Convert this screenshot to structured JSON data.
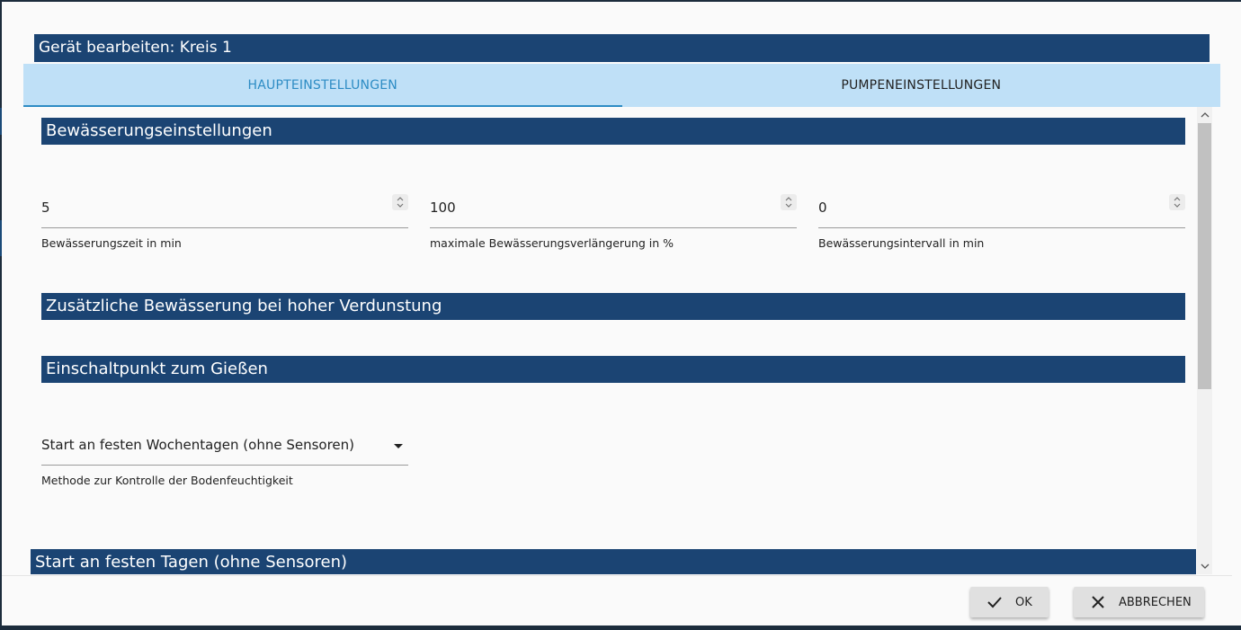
{
  "dialog": {
    "title": "Gerät bearbeiten: Kreis 1"
  },
  "tabs": [
    {
      "label": "HAUPTEINSTELLUNGEN",
      "active": true
    },
    {
      "label": "PUMPENEINSTELLUNGEN",
      "active": false
    }
  ],
  "sections": {
    "irrigation": "Bewässerungseinstellungen",
    "evaporation": "Zusätzliche Bewässerung bei hoher Verdunstung",
    "trigger": "Einschaltpunkt zum Gießen",
    "fixed_days": "Start an festen Tagen (ohne Sensoren)"
  },
  "fields": {
    "duration": {
      "value": "5",
      "label": "Bewässerungszeit in min"
    },
    "max_extension": {
      "value": "100",
      "label": "maximale Bewässerungsverlängerung in %"
    },
    "interval": {
      "value": "0",
      "label": "Bewässerungsintervall in min"
    },
    "method": {
      "value": "Start an festen Wochentagen (ohne Sensoren)",
      "label": "Methode zur Kontrolle der Bodenfeuchtigkeit"
    }
  },
  "buttons": {
    "ok": "OK",
    "cancel": "ABBRECHEN"
  },
  "colors": {
    "header_bg": "#1b4473",
    "tab_bar_bg": "#bfe0f7",
    "tab_active": "#2d8cc4"
  }
}
